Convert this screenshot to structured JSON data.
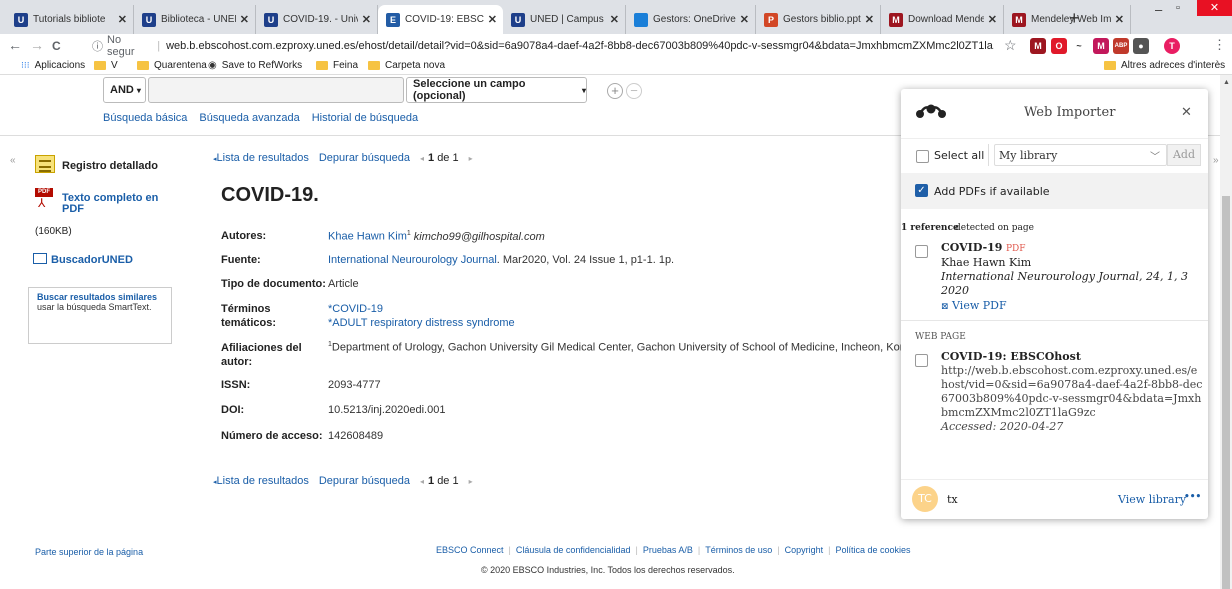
{
  "browser": {
    "tabs": [
      {
        "label": "Tutorials bibliote",
        "favicon": "U",
        "favicon_color": "#1e3f8a",
        "active": false
      },
      {
        "label": "Biblioteca - UNED",
        "favicon": "U",
        "favicon_color": "#1e3f8a",
        "active": false
      },
      {
        "label": "COVID-19. - Univ",
        "favicon": "U",
        "favicon_color": "#1e3f8a",
        "active": false
      },
      {
        "label": "COVID-19: EBSCO",
        "favicon": "E",
        "favicon_color": "#235ca5",
        "active": true
      },
      {
        "label": "UNED | Campus N",
        "favicon": "U",
        "favicon_color": "#1e3f8a",
        "active": false
      },
      {
        "label": "Gestors: OneDrive",
        "favicon": "",
        "favicon_color": "#1a7fd8",
        "active": false
      },
      {
        "label": "Gestors biblio.ppt",
        "favicon": "P",
        "favicon_color": "#d24726",
        "active": false
      },
      {
        "label": "Download Mende",
        "favicon": "M",
        "favicon_color": "#9d1620",
        "active": false
      },
      {
        "label": "Mendeley Web Im",
        "favicon": "M",
        "favicon_color": "#9d1620",
        "active": false
      }
    ],
    "new_tab": "+",
    "window_controls": [
      "–",
      "▫",
      "✕"
    ],
    "nav": {
      "back": "←",
      "forward": "→",
      "reload": "C"
    },
    "address": {
      "info_icon": "ⓘ",
      "security": "No segur",
      "url": "web.b.ebscohost.com.ezproxy.uned.es/ehost/detail/detail?vid=0&sid=6a9078a4-daef-4a2f-8bb8-dec67003b809%40pdc-v-sessmgr04&bdata=JmxhbmcmZXMmc2l0ZT1la..."
    },
    "star": "☆",
    "extensions": [
      {
        "name": "mendeley-ext-icon",
        "glyph": "M",
        "color": "#9d1620"
      },
      {
        "name": "opera-ext-icon",
        "glyph": "O",
        "color": "#e0192a"
      },
      {
        "name": "unknown-ext-icon",
        "glyph": "~",
        "color": "#333333"
      },
      {
        "name": "refworks-ext-icon",
        "glyph": "M",
        "color": "#c2185b"
      },
      {
        "name": "abp-ext-icon",
        "glyph": "ABP",
        "color": "#c0392b"
      },
      {
        "name": "bulb-ext-icon",
        "glyph": "●",
        "color": "#555555"
      },
      {
        "name": "profile-avatar-icon",
        "glyph": "T",
        "color": "#e91e63"
      }
    ],
    "bookmarks": [
      {
        "label": "Aplicacions",
        "type": "apps"
      },
      {
        "label": "V",
        "type": "folder"
      },
      {
        "label": "Quarentena",
        "type": "folder"
      },
      {
        "label": "Save to RefWorks",
        "type": "globe"
      },
      {
        "label": "Feina",
        "type": "folder"
      },
      {
        "label": "Carpeta nova",
        "type": "folder"
      }
    ],
    "other_bookmarks": "Altres adreces d'interès"
  },
  "search": {
    "bool_select": "AND",
    "field_select": "Seleccione un campo (opcional)",
    "links": [
      "Búsqueda básica",
      "Búsqueda avanzada",
      "Historial de búsqueda"
    ]
  },
  "sidebar": {
    "collapse": "«",
    "expand": "»",
    "record_label": "Registro detallado",
    "pdf_label": "Texto completo en PDF",
    "pdf_size": "(160KB)",
    "buscador": "BuscadorUNED",
    "similar_title": "Buscar resultados similares",
    "similar_sub": "usar la búsqueda SmartText."
  },
  "detail": {
    "result_nav": {
      "back": "Lista de resultados",
      "refine": "Depurar búsqueda",
      "counter_prefix": "1",
      "counter_suffix": "de 1"
    },
    "title": "COVID-19.",
    "fields": [
      {
        "label": "Autores:",
        "value": "Khae Hawn Kim",
        "value_sup": "1",
        "value_extra": "kimcho99@gilhospital.com"
      },
      {
        "label": "Fuente:",
        "value": "International Neurourology Journal",
        "value_extra": ". Mar2020, Vol. 24 Issue 1, p1-1. 1p."
      },
      {
        "label": "Tipo de documento:",
        "value": "Article"
      },
      {
        "label": "Términos temáticos:",
        "value": "*COVID-19",
        "value_extra": "*ADULT respiratory distress syndrome"
      },
      {
        "label": "Afiliaciones del autor:",
        "value_sup": "1",
        "value": "Department of Urology, Gachon University Gil Medical Center, Gachon University of School of Medicine, Incheon, Korea"
      },
      {
        "label": "ISSN:",
        "value": "2093-4777"
      },
      {
        "label": "DOI:",
        "value": "10.5213/inj.2020edi.001"
      },
      {
        "label": "Número de acceso:",
        "value": "142608489"
      }
    ]
  },
  "footer": {
    "top_link": "Parte superior de la página",
    "links": [
      "EBSCO Connect",
      "Cláusula de confidencialidad",
      "Pruebas A/B",
      "Términos de uso",
      "Copyright",
      "Política de cookies"
    ],
    "copyright": "© 2020 EBSCO Industries, Inc. Todos los derechos reservados."
  },
  "importer": {
    "title": "Web Importer",
    "close": "✕",
    "select_all": "Select all",
    "library": "My library",
    "add_button": "Add",
    "add_pdfs": "Add PDFs if available",
    "detected_count": "1 reference",
    "detected_text": "detected on page",
    "reference": {
      "title": "COVID-19",
      "pdf_badge": "PDF",
      "author": "Khae Hawn Kim",
      "journal": "International Neurourology Journal, 24, 1, 3 2020",
      "view_pdf": "View PDF"
    },
    "web_page_heading": "WEB PAGE",
    "web_page": {
      "title": "COVID-19: EBSCOhost",
      "url": "http://web.b.ebscohost.com.ezproxy.uned.es/ehost/vid=0&sid=6a9078a4-daef-4a2f-8bb8-dec67003b809%40pdc-v-sessmgr04&bdata=JmxhbmcmZXMmc2l0ZT1laG9zc",
      "accessed": "Accessed: 2020-04-27"
    },
    "user_initials": "TC",
    "user_name": "tx",
    "view_library": "View library",
    "more": "•••"
  }
}
